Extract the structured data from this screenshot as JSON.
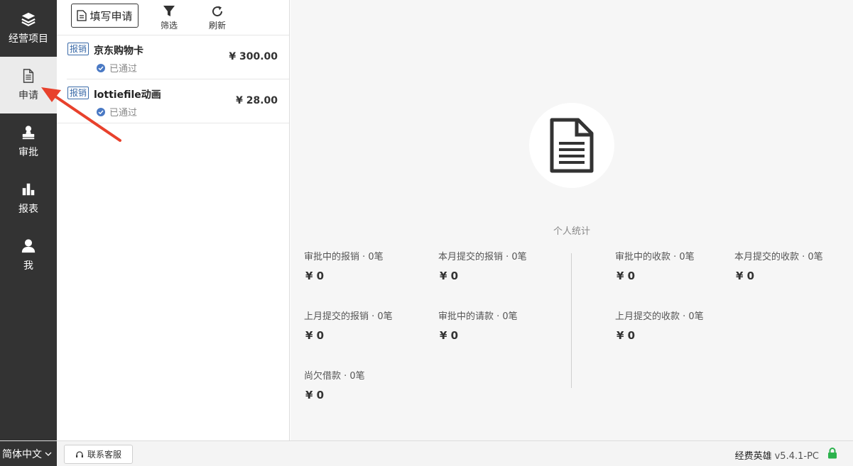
{
  "sidebar": {
    "items": [
      {
        "label": "经营项目",
        "icon": "layers-icon"
      },
      {
        "label": "申请",
        "icon": "document-icon"
      },
      {
        "label": "审批",
        "icon": "stamp-icon"
      },
      {
        "label": "报表",
        "icon": "bar-chart-icon"
      },
      {
        "label": "我",
        "icon": "user-icon"
      }
    ],
    "active_index": 1
  },
  "toolbar": {
    "fill_label": "填写申请",
    "filter_label": "筛选",
    "refresh_label": "刷新"
  },
  "list": [
    {
      "tag": "报销",
      "title": "京东购物卡",
      "status": "已通过",
      "amount": "¥ 300.00"
    },
    {
      "tag": "报销",
      "title": "lottiefile动画",
      "status": "已通过",
      "amount": "¥ 28.00"
    }
  ],
  "stats": {
    "title": "个人统计",
    "items": [
      {
        "label": "审批中的报销 · 0笔",
        "value": "¥ 0"
      },
      {
        "label": "本月提交的报销 · 0笔",
        "value": "¥ 0"
      },
      {
        "label": "上月提交的报销 · 0笔",
        "value": "¥ 0"
      },
      {
        "label": "审批中的请款 · 0笔",
        "value": "¥ 0"
      },
      {
        "label": "尚欠借款 · 0笔",
        "value": "¥ 0"
      },
      {
        "label": "审批中的收款 · 0笔",
        "value": "¥ 0"
      },
      {
        "label": "本月提交的收款 · 0笔",
        "value": "¥ 0"
      },
      {
        "label": "上月提交的收款 · 0笔",
        "value": "¥ 0"
      }
    ]
  },
  "footer": {
    "language": "简体中文",
    "support_label": "联系客服",
    "brand": "经费英雄",
    "version": "v5.4.1-PC"
  },
  "colors": {
    "sidebar_bg": "#333333",
    "tag_blue": "#3a6aa8",
    "status_check": "#4a79c4",
    "lock_green": "#2bb24c",
    "arrow_red": "#e8412c"
  }
}
